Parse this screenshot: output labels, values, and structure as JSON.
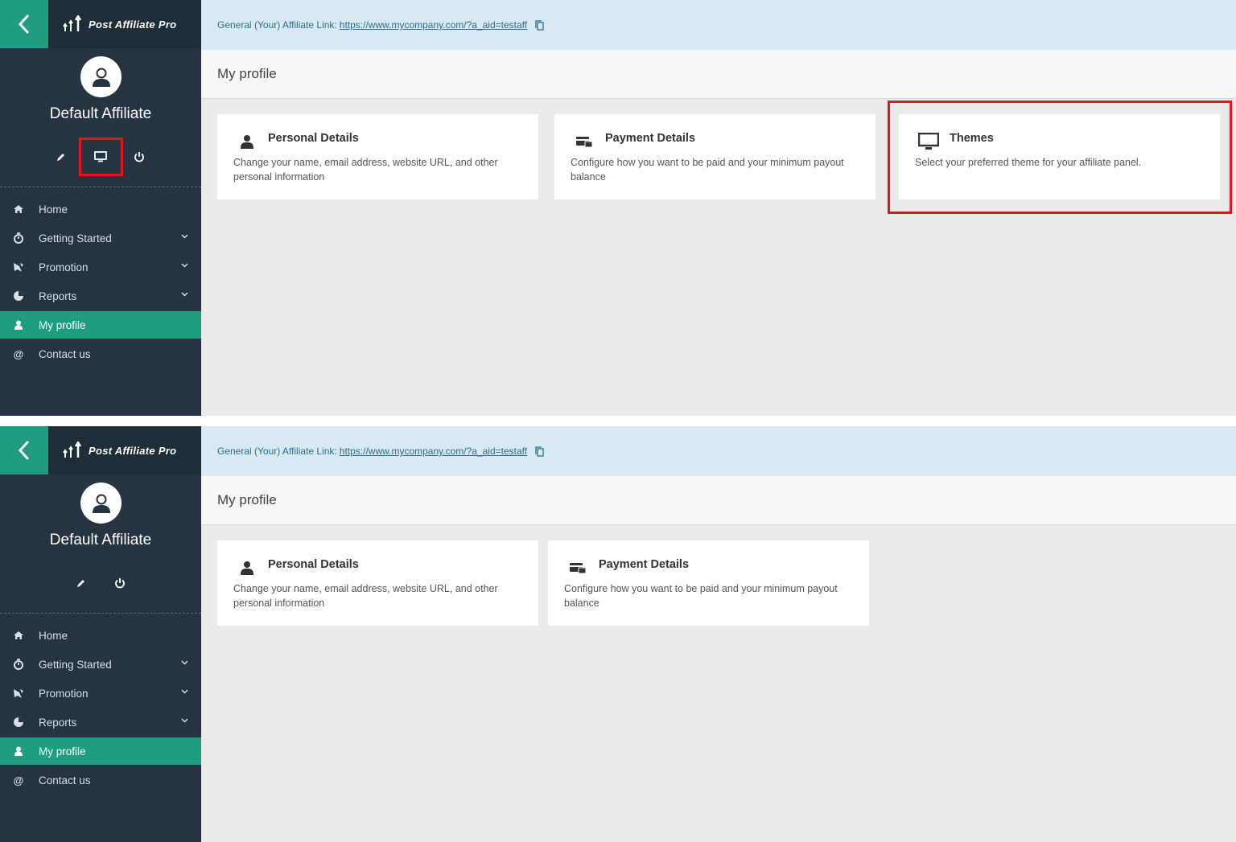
{
  "app": {
    "logo_text": "Post Affiliate Pro"
  },
  "colors": {
    "accent": "#1e9e7f",
    "sidebar": "#253342",
    "highlight": "#e5141c",
    "link_bar": "#d7eaf4"
  },
  "user": {
    "name": "Default Affiliate"
  },
  "affiliate_link": {
    "label": "General (Your) Affiliate Link:",
    "url": "https://www.mycompany.com/?a_aid=testaff"
  },
  "page": {
    "title": "My profile"
  },
  "menu": [
    {
      "label": "Home",
      "icon": "home-icon"
    },
    {
      "label": "Getting Started",
      "icon": "stopwatch-icon"
    },
    {
      "label": "Promotion",
      "icon": "bullhorn-icon"
    },
    {
      "label": "Reports",
      "icon": "pie-chart-icon"
    },
    {
      "label": "My profile",
      "icon": "user-icon"
    },
    {
      "label": "Contact us",
      "icon": "at-icon"
    }
  ],
  "cards": [
    {
      "title": "Personal Details",
      "description": "Change your name, email address, website URL, and other personal information",
      "icon": "user-icon"
    },
    {
      "title": "Payment Details",
      "description": "Configure how you want to be paid and your minimum payout balance",
      "icon": "payment-card-icon"
    },
    {
      "title": "Themes",
      "description": "Select your preferred theme for your affiliate panel.",
      "icon": "monitor-icon"
    }
  ]
}
